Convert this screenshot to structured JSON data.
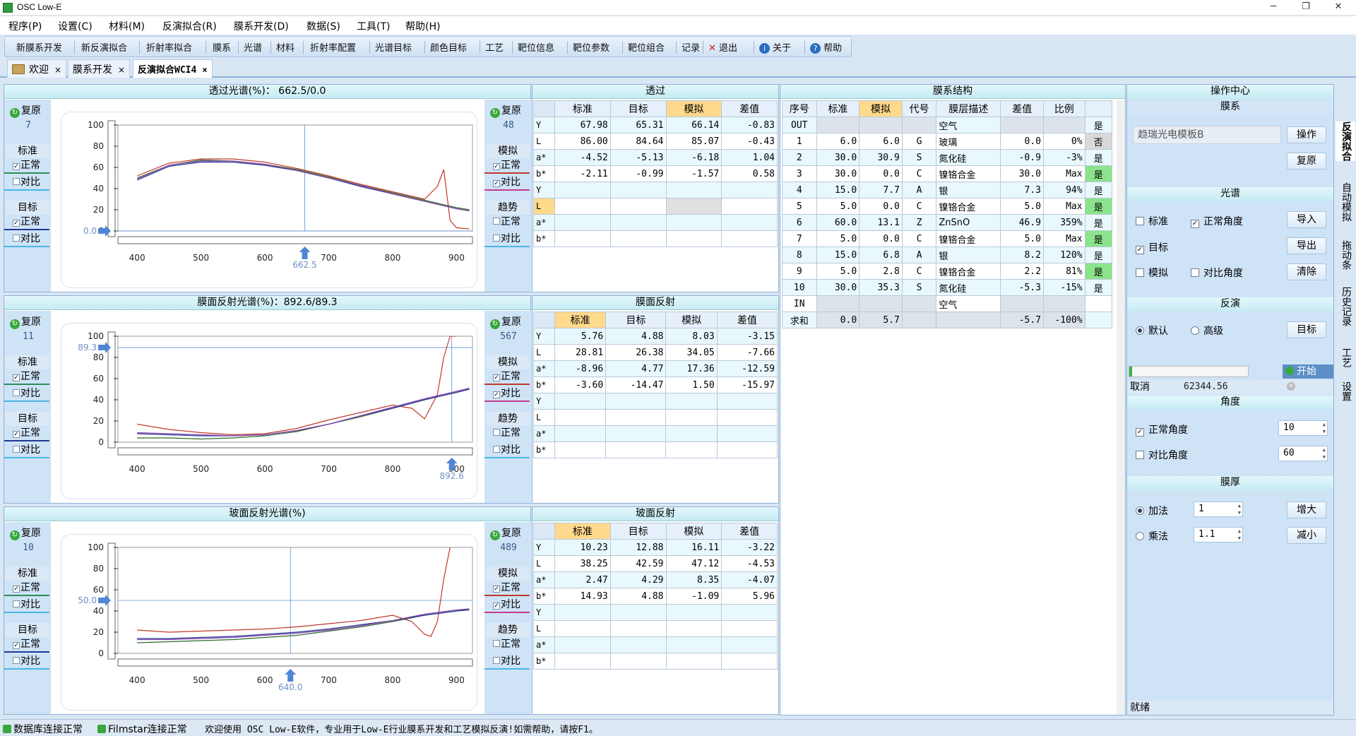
{
  "window": {
    "title": "OSC Low-E",
    "min": "─",
    "max": "❐",
    "close": "✕"
  },
  "menu": [
    "程序(P)",
    "设置(C)",
    "材料(M)",
    "反演拟合(R)",
    "膜系开发(D)",
    "数据(S)",
    "工具(T)",
    "帮助(H)"
  ],
  "toolbar": [
    "新膜系开发",
    "新反演拟合",
    "折射率拟合",
    "膜系",
    "光谱",
    "材料",
    "折射率配置",
    "光谱目标",
    "颜色目标",
    "工艺",
    "靶位信息",
    "靶位参数",
    "靶位组合",
    "记录"
  ],
  "toolbar_exit": "退出",
  "toolbar_about": "关于",
  "toolbar_help": "帮助",
  "tabs": [
    {
      "label": "欢迎"
    },
    {
      "label": "膜系开发"
    },
    {
      "label": "反演拟合WCI4"
    }
  ],
  "tab_close": "×",
  "left_common": {
    "reset": "复原",
    "std": "标准",
    "target": "目标",
    "normal": "正常",
    "compare": "对比",
    "sim": "模拟",
    "trend": "趋势"
  },
  "spectra": [
    {
      "title": "透过光谱(%)：  662.5/0.0",
      "left_count": "7",
      "right_count": "48",
      "ymark": "0.0",
      "xmark": "662.5",
      "yticks": [
        "100",
        "80",
        "60",
        "40",
        "20",
        "0"
      ],
      "xticks": [
        "400",
        "500",
        "600",
        "700",
        "800",
        "900"
      ]
    },
    {
      "title": "膜面反射光谱(%)：892.6/89.3",
      "left_count": "11",
      "right_count": "567",
      "ymark": "89.3",
      "xmark": "892.6",
      "yticks": [
        "100",
        "80",
        "60",
        "40",
        "20",
        "0"
      ],
      "xticks": [
        "400",
        "500",
        "600",
        "700",
        "800",
        "900"
      ]
    },
    {
      "title": "玻面反射光谱(%)",
      "left_count": "10",
      "right_count": "489",
      "ymark": "50.0",
      "xmark": "640.0",
      "yticks": [
        "100",
        "80",
        "60",
        "40",
        "20",
        "0"
      ],
      "xticks": [
        "400",
        "500",
        "600",
        "700",
        "800",
        "900"
      ]
    }
  ],
  "color_tables": [
    {
      "title": "透过",
      "headers": [
        "标准",
        "目标",
        "模拟",
        "差值"
      ],
      "rows": [
        [
          "Y",
          "67.98",
          "65.31",
          "66.14",
          "-0.83"
        ],
        [
          "L",
          "86.00",
          "84.64",
          "85.07",
          "-0.43"
        ],
        [
          "a*",
          "-4.52",
          "-5.13",
          "-6.18",
          "1.04"
        ],
        [
          "b*",
          "-2.11",
          "-0.99",
          "-1.57",
          "0.58"
        ],
        [
          "Y",
          "",
          "",
          "",
          ""
        ],
        [
          "L",
          "",
          "",
          "",
          ""
        ],
        [
          "a*",
          "",
          "",
          "",
          ""
        ],
        [
          "b*",
          "",
          "",
          "",
          ""
        ]
      ]
    },
    {
      "title": "膜面反射",
      "headers": [
        "标准",
        "目标",
        "模拟",
        "差值"
      ],
      "rows": [
        [
          "Y",
          "5.76",
          "4.88",
          "8.03",
          "-3.15"
        ],
        [
          "L",
          "28.81",
          "26.38",
          "34.05",
          "-7.66"
        ],
        [
          "a*",
          "-8.96",
          "4.77",
          "17.36",
          "-12.59"
        ],
        [
          "b*",
          "-3.60",
          "-14.47",
          "1.50",
          "-15.97"
        ],
        [
          "Y",
          "",
          "",
          "",
          ""
        ],
        [
          "L",
          "",
          "",
          "",
          ""
        ],
        [
          "a*",
          "",
          "",
          "",
          ""
        ],
        [
          "b*",
          "",
          "",
          "",
          ""
        ]
      ]
    },
    {
      "title": "玻面反射",
      "headers": [
        "标准",
        "目标",
        "模拟",
        "差值"
      ],
      "rows": [
        [
          "Y",
          "10.23",
          "12.88",
          "16.11",
          "-3.22"
        ],
        [
          "L",
          "38.25",
          "42.59",
          "47.12",
          "-4.53"
        ],
        [
          "a*",
          "2.47",
          "4.29",
          "8.35",
          "-4.07"
        ],
        [
          "b*",
          "14.93",
          "4.88",
          "-1.09",
          "5.96"
        ],
        [
          "Y",
          "",
          "",
          "",
          ""
        ],
        [
          "L",
          "",
          "",
          "",
          ""
        ],
        [
          "a*",
          "",
          "",
          "",
          ""
        ],
        [
          "b*",
          "",
          "",
          "",
          ""
        ]
      ]
    }
  ],
  "layers": {
    "title": "膜系结构",
    "headers": [
      "序号",
      "标准",
      "模拟",
      "代号",
      "膜层描述",
      "差值",
      "比例",
      ""
    ],
    "rows": [
      [
        "OUT",
        "",
        "",
        "",
        "空气",
        "",
        "",
        "是"
      ],
      [
        "1",
        "6.0",
        "6.0",
        "G",
        "玻璃",
        "0.0",
        "0%",
        "否"
      ],
      [
        "2",
        "30.0",
        "30.9",
        "S",
        "氮化硅",
        "-0.9",
        "-3%",
        "是"
      ],
      [
        "3",
        "30.0",
        "0.0",
        "C",
        "镍铬合金",
        "30.0",
        "Max",
        "是"
      ],
      [
        "4",
        "15.0",
        "7.7",
        "A",
        "银",
        "7.3",
        "94%",
        "是"
      ],
      [
        "5",
        "5.0",
        "0.0",
        "C",
        "镍铬合金",
        "5.0",
        "Max",
        "是"
      ],
      [
        "6",
        "60.0",
        "13.1",
        "Z",
        "ZnSnO",
        "46.9",
        "359%",
        "是"
      ],
      [
        "7",
        "5.0",
        "0.0",
        "C",
        "镍铬合金",
        "5.0",
        "Max",
        "是"
      ],
      [
        "8",
        "15.0",
        "6.8",
        "A",
        "银",
        "8.2",
        "120%",
        "是"
      ],
      [
        "9",
        "5.0",
        "2.8",
        "C",
        "镍铬合金",
        "2.2",
        "81%",
        "是"
      ],
      [
        "10",
        "30.0",
        "35.3",
        "S",
        "氮化硅",
        "-5.3",
        "-15%",
        "是"
      ],
      [
        "IN",
        "",
        "",
        "",
        "空气",
        "",
        "",
        ""
      ],
      [
        "求和",
        "0.0",
        "5.7",
        "",
        "",
        "-5.7",
        "-100%",
        ""
      ]
    ]
  },
  "ops": {
    "title": "操作中心",
    "film": "膜系",
    "film_input": "趋瑞光电模板B",
    "btn_op": "操作",
    "btn_reset": "复原",
    "spectrum": "光谱",
    "cb_std": "标准",
    "cb_normal_angle": "正常角度",
    "cb_target": "目标",
    "cb_sim": "模拟",
    "cb_compare_angle": "对比角度",
    "btn_import": "导入",
    "btn_export": "导出",
    "btn_clear": "清除",
    "inversion": "反演",
    "rb_default": "默认",
    "rb_advanced": "高级",
    "btn_target": "目标",
    "btn_start": "开始",
    "cancel": "取消",
    "merit": "62344.56",
    "angle": "角度",
    "normal_angle": "正常角度",
    "normal_angle_val": "10",
    "compare_angle": "对比角度",
    "compare_angle_val": "60",
    "thickness": "膜厚",
    "rb_add": "加法",
    "add_val": "1",
    "rb_mul": "乘法",
    "mul_val": "1.1",
    "btn_increase": "增大",
    "btn_decrease": "减小",
    "status": "就绪"
  },
  "vtabs": [
    "反演拟合",
    "自动模拟",
    "拖动条",
    "历史记录",
    "工艺",
    "设置"
  ],
  "status": {
    "db": "数据库连接正常",
    "filmstar": "Filmstar连接正常",
    "msg": "欢迎使用 OSC Low-E软件，专业用于Low-E行业膜系开发和工艺模拟反演!如需帮助，请按F1。"
  },
  "chart_data": [
    {
      "type": "line",
      "title": "透过光谱(%)：  662.5/0.0",
      "ylim": [
        0,
        100
      ],
      "xlim": [
        370,
        925
      ],
      "series": [
        {
          "color": "#c0392b",
          "x": [
            400,
            450,
            500,
            550,
            600,
            650,
            700,
            750,
            800,
            850,
            870,
            880,
            890,
            900,
            920
          ],
          "values": [
            52,
            64,
            68,
            68,
            65,
            59,
            52,
            44,
            37,
            30,
            42,
            58,
            10,
            3,
            2
          ]
        },
        {
          "color": "#2b6b2b",
          "x": [
            400,
            450,
            500,
            550,
            600,
            650,
            700,
            750,
            800,
            850,
            900,
            920
          ],
          "values": [
            50,
            62,
            67,
            66,
            63,
            58,
            51,
            43,
            36,
            29,
            22,
            20
          ]
        },
        {
          "color": "#1f3a93",
          "x": [
            400,
            450,
            500,
            550,
            600,
            650,
            700,
            750,
            800,
            850,
            900,
            920
          ],
          "values": [
            48,
            61,
            65,
            65,
            62,
            57,
            50,
            42,
            35,
            28,
            21,
            19
          ]
        },
        {
          "color": "#8e44ad",
          "x": [
            400,
            450,
            500,
            550,
            600,
            650,
            700,
            750,
            800,
            850,
            900,
            920
          ],
          "values": [
            49,
            62,
            66,
            66,
            63,
            57,
            50,
            43,
            35,
            28,
            21,
            19
          ]
        }
      ]
    },
    {
      "type": "line",
      "title": "膜面反射光谱(%)：892.6/89.3",
      "ylim": [
        0,
        100
      ],
      "xlim": [
        370,
        925
      ],
      "series": [
        {
          "color": "#c0392b",
          "x": [
            400,
            450,
            500,
            550,
            600,
            650,
            700,
            750,
            800,
            830,
            850,
            870,
            880,
            890,
            900
          ],
          "values": [
            17,
            12,
            9,
            7,
            8,
            13,
            21,
            28,
            35,
            32,
            22,
            45,
            80,
            100,
            100
          ]
        },
        {
          "color": "#2b6b2b",
          "x": [
            400,
            450,
            500,
            550,
            600,
            650,
            700,
            750,
            800,
            850,
            900,
            920
          ],
          "values": [
            4,
            4,
            3,
            4,
            6,
            10,
            17,
            24,
            32,
            40,
            47,
            50
          ]
        },
        {
          "color": "#1f3a93",
          "x": [
            400,
            450,
            500,
            550,
            600,
            650,
            700,
            750,
            800,
            850,
            900,
            920
          ],
          "values": [
            8,
            7,
            6,
            6,
            7,
            11,
            17,
            25,
            32,
            40,
            47,
            50
          ]
        },
        {
          "color": "#8e44ad",
          "x": [
            400,
            450,
            500,
            550,
            600,
            650,
            700,
            750,
            800,
            850,
            900,
            920
          ],
          "values": [
            9,
            8,
            7,
            6,
            7,
            11,
            17,
            25,
            33,
            41,
            48,
            51
          ]
        }
      ]
    },
    {
      "type": "line",
      "title": "玻面反射光谱(%)",
      "ylim": [
        0,
        100
      ],
      "xlim": [
        370,
        925
      ],
      "series": [
        {
          "color": "#c0392b",
          "x": [
            400,
            450,
            500,
            550,
            600,
            650,
            700,
            750,
            800,
            830,
            850,
            860,
            870,
            880,
            890
          ],
          "values": [
            22,
            20,
            21,
            22,
            23,
            25,
            28,
            31,
            36,
            30,
            18,
            16,
            30,
            70,
            100
          ]
        },
        {
          "color": "#2b6b2b",
          "x": [
            400,
            450,
            500,
            550,
            600,
            650,
            700,
            750,
            800,
            850,
            900,
            920
          ],
          "values": [
            10,
            11,
            12,
            13,
            15,
            17,
            21,
            25,
            30,
            36,
            40,
            42
          ]
        },
        {
          "color": "#1f3a93",
          "x": [
            400,
            450,
            500,
            550,
            600,
            650,
            700,
            750,
            800,
            850,
            900,
            920
          ],
          "values": [
            14,
            14,
            15,
            16,
            18,
            20,
            23,
            27,
            31,
            36,
            40,
            41
          ]
        },
        {
          "color": "#8e44ad",
          "x": [
            400,
            450,
            500,
            550,
            600,
            650,
            700,
            750,
            800,
            850,
            900,
            920
          ],
          "values": [
            13,
            13,
            14,
            15,
            17,
            19,
            22,
            26,
            31,
            37,
            41,
            42
          ]
        }
      ]
    }
  ]
}
